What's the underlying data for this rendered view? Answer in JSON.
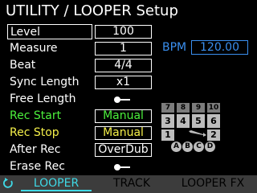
{
  "title": "UTILITY / LOOPER Setup",
  "params": [
    {
      "label": "Level",
      "value": "100"
    },
    {
      "label": "Measure",
      "value": "1"
    },
    {
      "label": "Beat",
      "value": "4/4"
    },
    {
      "label": "Sync Length",
      "value": "x1"
    },
    {
      "label": "Free Length",
      "value": "off"
    },
    {
      "label": "Rec Start",
      "value": "Manual"
    },
    {
      "label": "Rec Stop",
      "value": "Manual"
    },
    {
      "label": "After Rec",
      "value": "OverDub"
    },
    {
      "label": "Erase Rec",
      "value": "off"
    }
  ],
  "bpm": {
    "label": "BPM",
    "value": "120.00"
  },
  "pedal": {
    "top_row": [
      "7",
      "8",
      "9",
      "10"
    ],
    "mid_row": [
      "3",
      "4",
      "5",
      "6"
    ],
    "left_key": "1",
    "right_key": "2",
    "circles": [
      "A",
      "B",
      "C",
      "D"
    ]
  },
  "tabs": [
    "LOOPER",
    "TRACK",
    "LOOPER FX"
  ],
  "active_tab": "LOOPER",
  "icons": {
    "back": "back-arrow-icon",
    "toggle": "toggle-switch-icon"
  },
  "colors": {
    "accent": "#3fd9e6",
    "bpm": "#3a8fef",
    "green": "#4cf03c",
    "yellow": "#f5f04a",
    "tab_bar": "#3c3c3c"
  }
}
